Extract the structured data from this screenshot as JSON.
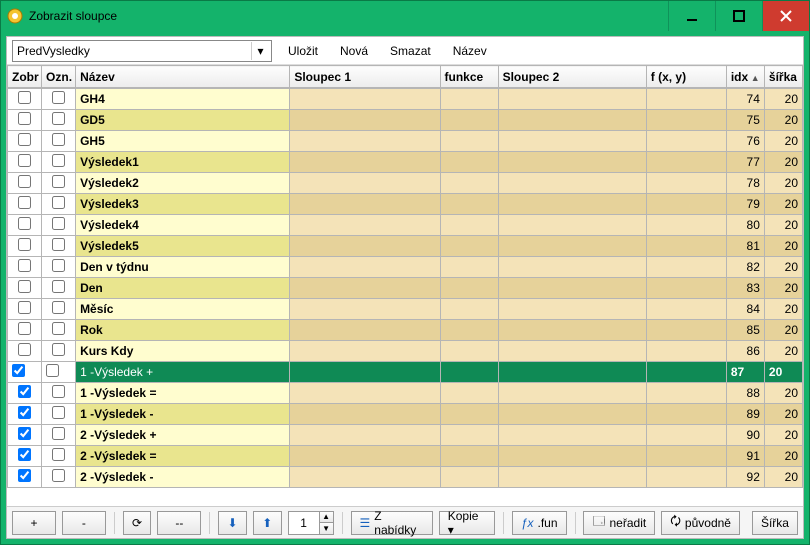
{
  "window": {
    "title": "Zobrazit sloupce"
  },
  "toolbar": {
    "combo_value": "PredVysledky",
    "ulozit": "Uložit",
    "nova": "Nová",
    "smazat": "Smazat",
    "nazev": "Název"
  },
  "columns": {
    "zobr": "Zobr",
    "ozn": "Ozn.",
    "nazev": "Název",
    "sloupec1": "Sloupec 1",
    "funkce": "funkce",
    "sloupec2": "Sloupec 2",
    "fxy": "f (x, y)",
    "idx": "idx",
    "sirka": "šířka"
  },
  "rows": [
    {
      "zobr": false,
      "ozn": false,
      "nazev": "GH4",
      "idx": "74",
      "sirka": "20",
      "bold": true,
      "sel": false
    },
    {
      "zobr": false,
      "ozn": false,
      "nazev": "GD5",
      "idx": "75",
      "sirka": "20",
      "bold": true,
      "sel": false
    },
    {
      "zobr": false,
      "ozn": false,
      "nazev": "GH5",
      "idx": "76",
      "sirka": "20",
      "bold": true,
      "sel": false
    },
    {
      "zobr": false,
      "ozn": false,
      "nazev": "Výsledek1",
      "idx": "77",
      "sirka": "20",
      "bold": true,
      "sel": false
    },
    {
      "zobr": false,
      "ozn": false,
      "nazev": "Výsledek2",
      "idx": "78",
      "sirka": "20",
      "bold": true,
      "sel": false
    },
    {
      "zobr": false,
      "ozn": false,
      "nazev": "Výsledek3",
      "idx": "79",
      "sirka": "20",
      "bold": true,
      "sel": false
    },
    {
      "zobr": false,
      "ozn": false,
      "nazev": "Výsledek4",
      "idx": "80",
      "sirka": "20",
      "bold": true,
      "sel": false
    },
    {
      "zobr": false,
      "ozn": false,
      "nazev": "Výsledek5",
      "idx": "81",
      "sirka": "20",
      "bold": true,
      "sel": false
    },
    {
      "zobr": false,
      "ozn": false,
      "nazev": "Den v týdnu",
      "idx": "82",
      "sirka": "20",
      "bold": true,
      "sel": false
    },
    {
      "zobr": false,
      "ozn": false,
      "nazev": "Den",
      "idx": "83",
      "sirka": "20",
      "bold": true,
      "sel": false
    },
    {
      "zobr": false,
      "ozn": false,
      "nazev": "Měsíc",
      "idx": "84",
      "sirka": "20",
      "bold": true,
      "sel": false
    },
    {
      "zobr": false,
      "ozn": false,
      "nazev": "Rok",
      "idx": "85",
      "sirka": "20",
      "bold": true,
      "sel": false
    },
    {
      "zobr": false,
      "ozn": false,
      "nazev": "Kurs Kdy",
      "idx": "86",
      "sirka": "20",
      "bold": true,
      "sel": false
    },
    {
      "zobr": true,
      "ozn": false,
      "nazev": "1 -Výsledek +",
      "idx": "87",
      "sirka": "20",
      "bold": false,
      "sel": true
    },
    {
      "zobr": true,
      "ozn": false,
      "nazev": "1 -Výsledek =",
      "idx": "88",
      "sirka": "20",
      "bold": true,
      "sel": false
    },
    {
      "zobr": true,
      "ozn": false,
      "nazev": "1 -Výsledek -",
      "idx": "89",
      "sirka": "20",
      "bold": true,
      "sel": false
    },
    {
      "zobr": true,
      "ozn": false,
      "nazev": "2 -Výsledek +",
      "idx": "90",
      "sirka": "20",
      "bold": true,
      "sel": false
    },
    {
      "zobr": true,
      "ozn": false,
      "nazev": "2 -Výsledek =",
      "idx": "91",
      "sirka": "20",
      "bold": true,
      "sel": false
    },
    {
      "zobr": true,
      "ozn": false,
      "nazev": "2 -Výsledek -",
      "idx": "92",
      "sirka": "20",
      "bold": true,
      "sel": false
    }
  ],
  "bottom": {
    "plus": "+",
    "minus": "-",
    "dashdash": "--",
    "spin_value": "1",
    "z_nabidky": "Z nabídky",
    "kopie": "Kopie ▾",
    "fun": ".fun",
    "neradit": "neřadit",
    "puvodne": "původně",
    "sirka": "Šířka"
  }
}
